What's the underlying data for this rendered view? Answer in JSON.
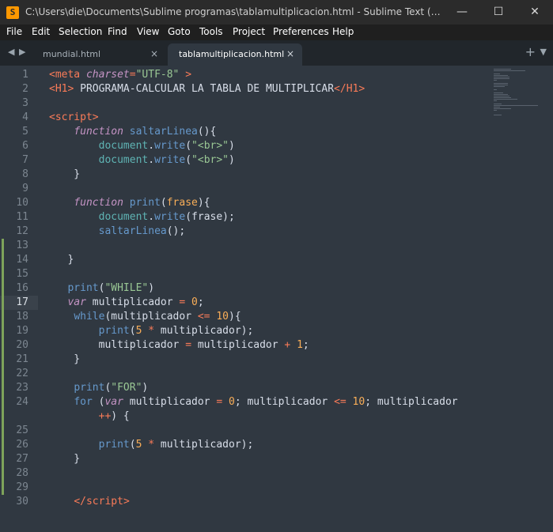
{
  "window": {
    "title": "C:\\Users\\die\\Documents\\Sublime programas\\tablamultiplicacion.html - Sublime Text (UNREGISTE...",
    "app_icon_glyph": "S"
  },
  "menu": [
    "File",
    "Edit",
    "Selection",
    "Find",
    "View",
    "Goto",
    "Tools",
    "Project",
    "Preferences",
    "Help"
  ],
  "tabs": [
    {
      "label": "mundial.html",
      "active": false,
      "close": "×"
    },
    {
      "label": "tablamultiplicacion.html",
      "active": true,
      "close": "×"
    }
  ],
  "tabbar_controls": {
    "prev": "◀",
    "next": "▶",
    "new_tab": "+",
    "tab_list": "▼"
  },
  "window_controls": {
    "minimize": "—",
    "maximize": "☐",
    "close": "✕"
  },
  "current_line": 17,
  "line_numbers": [
    "1",
    "2",
    "3",
    "4",
    "5",
    "6",
    "7",
    "8",
    "9",
    "10",
    "11",
    "12",
    "13",
    "14",
    "15",
    "16",
    "17",
    "18",
    "19",
    "20",
    "21",
    "22",
    "23",
    "24",
    "25",
    "26",
    "27",
    "28",
    "29",
    "30"
  ],
  "code_lines": [
    [
      [
        "tg",
        "<"
      ],
      [
        "tg",
        "meta"
      ],
      [
        "",
        ""
      ],
      [
        "at",
        " charset"
      ],
      [
        "op",
        "="
      ],
      [
        "st",
        "\"UTF-8\""
      ],
      [
        "tg",
        " >"
      ]
    ],
    [
      [
        "tg",
        "<"
      ],
      [
        "tg",
        "H1"
      ],
      [
        "tg",
        ">"
      ],
      [
        "",
        " PROGRAMA-CALCULAR LA TABLA DE MULTIPLICAR"
      ],
      [
        "tg",
        "</"
      ],
      [
        "tg",
        "H1"
      ],
      [
        "tg",
        ">"
      ]
    ],
    [],
    [
      [
        "tg",
        "<"
      ],
      [
        "tg",
        "script"
      ],
      [
        "tg",
        ">"
      ]
    ],
    [
      [
        "",
        "    "
      ],
      [
        "kw",
        "function"
      ],
      [
        "",
        " "
      ],
      [
        "fn",
        "saltarLinea"
      ],
      [
        "",
        "(){"
      ]
    ],
    [
      [
        "",
        "        "
      ],
      [
        "br",
        "document"
      ],
      [
        "",
        "."
      ],
      [
        "fn",
        "write"
      ],
      [
        "",
        "("
      ],
      [
        "st",
        "\"<br>\""
      ],
      [
        "",
        ")"
      ]
    ],
    [
      [
        "",
        "        "
      ],
      [
        "br",
        "document"
      ],
      [
        "",
        "."
      ],
      [
        "fn",
        "write"
      ],
      [
        "",
        "("
      ],
      [
        "st",
        "\"<br>\""
      ],
      [
        "",
        ")"
      ]
    ],
    [
      [
        "",
        "    }"
      ]
    ],
    [],
    [
      [
        "",
        "    "
      ],
      [
        "kw",
        "function"
      ],
      [
        "",
        " "
      ],
      [
        "fn",
        "print"
      ],
      [
        "",
        "("
      ],
      [
        "num",
        "frase"
      ],
      [
        "",
        "){"
      ]
    ],
    [
      [
        "",
        "        "
      ],
      [
        "br",
        "document"
      ],
      [
        "",
        "."
      ],
      [
        "fn",
        "write"
      ],
      [
        "",
        "(frase);"
      ]
    ],
    [
      [
        "",
        "        "
      ],
      [
        "fn",
        "saltarLinea"
      ],
      [
        "",
        "();"
      ]
    ],
    [],
    [
      [
        "",
        "   }"
      ]
    ],
    [],
    [
      [
        "",
        "   "
      ],
      [
        "fn",
        "print"
      ],
      [
        "",
        "("
      ],
      [
        "st",
        "\"WHILE\""
      ],
      [
        "",
        ")"
      ]
    ],
    [
      [
        "",
        "   "
      ],
      [
        "kw",
        "var"
      ],
      [
        "",
        " multiplicador "
      ],
      [
        "op",
        "="
      ],
      [
        "",
        " "
      ],
      [
        "num",
        "0"
      ],
      [
        "",
        ";"
      ]
    ],
    [
      [
        "",
        "    "
      ],
      [
        "kw2",
        "while"
      ],
      [
        "",
        "(multiplicador "
      ],
      [
        "op",
        "<="
      ],
      [
        "",
        " "
      ],
      [
        "num",
        "10"
      ],
      [
        "",
        "){"
      ]
    ],
    [
      [
        "",
        "        "
      ],
      [
        "fn",
        "print"
      ],
      [
        "",
        "("
      ],
      [
        "num",
        "5"
      ],
      [
        "",
        " "
      ],
      [
        "op",
        "*"
      ],
      [
        "",
        " multiplicador);"
      ]
    ],
    [
      [
        "",
        "        multiplicador "
      ],
      [
        "op",
        "="
      ],
      [
        "",
        " multiplicador "
      ],
      [
        "op",
        "+"
      ],
      [
        "",
        " "
      ],
      [
        "num",
        "1"
      ],
      [
        "",
        ";"
      ]
    ],
    [
      [
        "",
        "    }"
      ]
    ],
    [],
    [
      [
        "",
        "    "
      ],
      [
        "fn",
        "print"
      ],
      [
        "",
        "("
      ],
      [
        "st",
        "\"FOR\""
      ],
      [
        "",
        ")"
      ]
    ],
    [
      [
        "",
        "    "
      ],
      [
        "kw2",
        "for"
      ],
      [
        "",
        " ("
      ],
      [
        "kw",
        "var"
      ],
      [
        "",
        " multiplicador "
      ],
      [
        "op",
        "="
      ],
      [
        "",
        " "
      ],
      [
        "num",
        "0"
      ],
      [
        "",
        "; multiplicador "
      ],
      [
        "op",
        "<="
      ],
      [
        "",
        " "
      ],
      [
        "num",
        "10"
      ],
      [
        "",
        "; multiplicador"
      ]
    ],
    [
      [
        "",
        "        "
      ],
      [
        "op",
        "++"
      ],
      [
        "",
        ") {"
      ]
    ],
    [
      [
        "",
        "        "
      ],
      [
        "fn",
        "print"
      ],
      [
        "",
        "("
      ],
      [
        "num",
        "5"
      ],
      [
        "",
        " "
      ],
      [
        "op",
        "*"
      ],
      [
        "",
        " multiplicador);"
      ]
    ],
    [
      [
        "",
        "    }"
      ]
    ],
    [],
    [],
    [
      [
        "",
        "    "
      ],
      [
        "tg",
        "</"
      ],
      [
        "tg",
        "script"
      ],
      [
        "tg",
        ">"
      ]
    ]
  ],
  "colors": {
    "background": "#303841",
    "titlebar": "#2b2b2b",
    "menubar": "#1f1f1f",
    "tabbar": "#21262b",
    "accent_icon": "#ff9800",
    "modified_marker": "#7ea35a"
  }
}
